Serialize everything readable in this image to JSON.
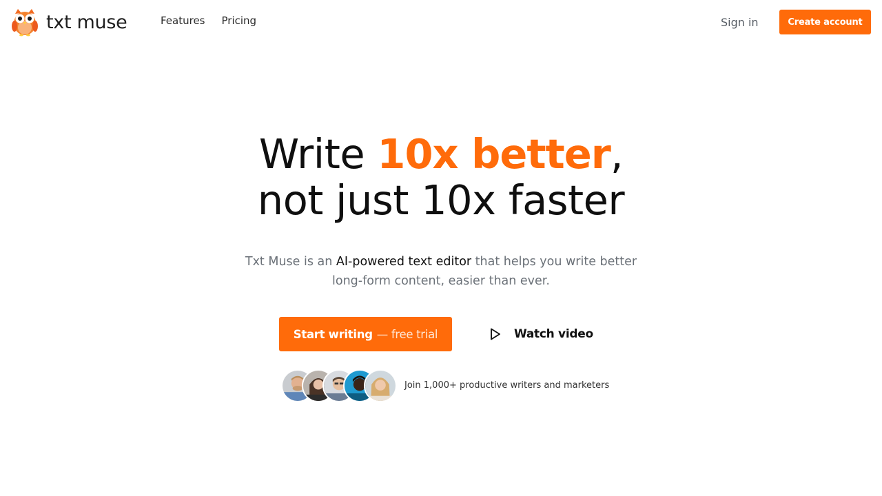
{
  "header": {
    "logo_text": "txt muse",
    "logo_icon": "owl-logo-icon",
    "nav": [
      {
        "label": "Features"
      },
      {
        "label": "Pricing"
      }
    ],
    "sign_in_label": "Sign in",
    "create_account_label": "Create account"
  },
  "hero": {
    "title_line1_prefix": "Write ",
    "title_line1_accent": "10x better",
    "title_line1_suffix": ",",
    "title_line2": "not just 10x faster",
    "subtitle_prefix": "Txt Muse is an ",
    "subtitle_strong": "AI-powered text editor",
    "subtitle_suffix": " that helps you write better long-form content, easier than ever.",
    "start_button_bold": "Start writing",
    "start_button_light": "— free trial",
    "watch_video_label": "Watch video",
    "watch_video_icon": "play-icon"
  },
  "social_proof": {
    "avatars": [
      {
        "name": "avatar-1"
      },
      {
        "name": "avatar-2"
      },
      {
        "name": "avatar-3"
      },
      {
        "name": "avatar-4"
      },
      {
        "name": "avatar-5"
      }
    ],
    "text": "Join 1,000+ productive writers and marketers"
  },
  "colors": {
    "accent": "#ff6b0a",
    "text_primary": "#111111",
    "text_muted": "#6b7178",
    "background": "#ffffff"
  }
}
